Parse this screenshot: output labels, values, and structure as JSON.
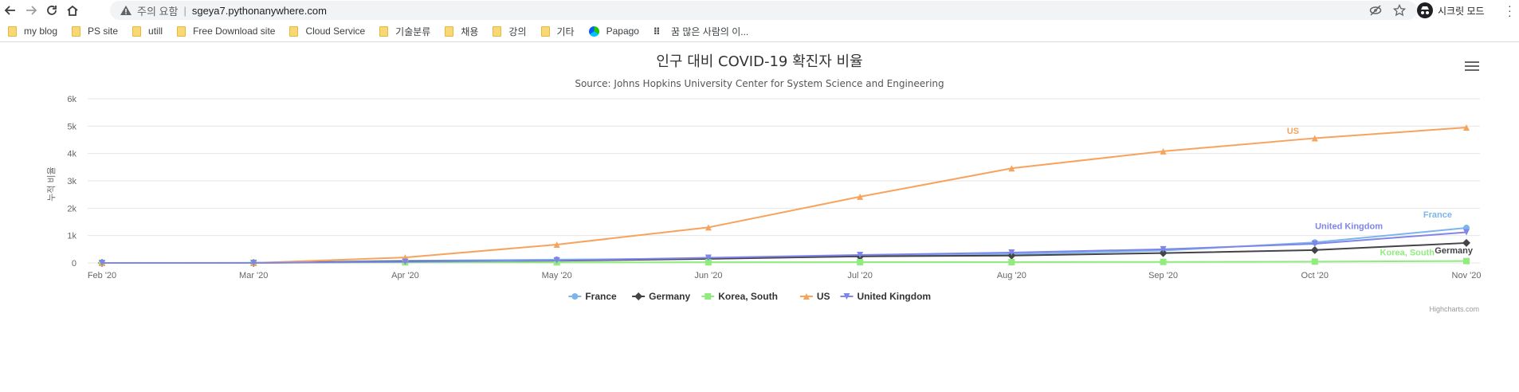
{
  "browser": {
    "security_label": "주의 요함",
    "url": "sgeya7.pythonanywhere.com",
    "incognito_label": "시크릿 모드"
  },
  "bookmarks": [
    {
      "label": "my blog",
      "icon": "folder-icon"
    },
    {
      "label": "PS site",
      "icon": "folder-icon"
    },
    {
      "label": "utill",
      "icon": "folder-icon"
    },
    {
      "label": "Free Download site",
      "icon": "folder-icon"
    },
    {
      "label": "Cloud Service",
      "icon": "folder-icon"
    },
    {
      "label": "기술분류",
      "icon": "folder-icon"
    },
    {
      "label": "채용",
      "icon": "folder-icon"
    },
    {
      "label": "강의",
      "icon": "folder-icon"
    },
    {
      "label": "기타",
      "icon": "folder-icon"
    },
    {
      "label": "Papago",
      "icon": "papago-icon"
    },
    {
      "label": "꿈 많은 사람의 이...",
      "icon": "dots-icon"
    }
  ],
  "chart_data": {
    "type": "line",
    "title": "인구 대비 COVID-19 확진자 비율",
    "subtitle": "Source: Johns Hopkins University Center for System Science and Engineering",
    "ylabel": "누적 비율",
    "ylim": [
      0,
      6000
    ],
    "yticks": [
      "0",
      "1k",
      "2k",
      "3k",
      "4k",
      "5k",
      "6k"
    ],
    "ytick_values": [
      0,
      1000,
      2000,
      3000,
      4000,
      5000,
      6000
    ],
    "xticks": [
      "Feb '20",
      "Mar '20",
      "Apr '20",
      "May '20",
      "Jun '20",
      "Jul '20",
      "Aug '20",
      "Sep '20",
      "Oct '20",
      "Nov '20"
    ],
    "x": [
      "2020-01-31",
      "2020-02-29",
      "2020-03-31",
      "2020-04-30",
      "2020-05-31",
      "2020-06-30",
      "2020-07-31",
      "2020-08-31",
      "2020-09-30",
      "2020-10-31"
    ],
    "series": [
      {
        "name": "France",
        "color": "#7cb5ec",
        "marker": "circle",
        "values": [
          0,
          2,
          80,
          120,
          160,
          240,
          320,
          450,
          750,
          1280
        ]
      },
      {
        "name": "Germany",
        "color": "#434348",
        "marker": "diamond",
        "values": [
          0,
          1,
          60,
          80,
          150,
          240,
          270,
          360,
          470,
          730
        ]
      },
      {
        "name": "Korea, South",
        "color": "#90ed7d",
        "marker": "square",
        "values": [
          0,
          5,
          20,
          20,
          25,
          28,
          30,
          38,
          47,
          68
        ]
      },
      {
        "name": "US",
        "color": "#f7a35c",
        "marker": "triangle",
        "values": [
          0,
          0,
          200,
          670,
          1300,
          2420,
          3460,
          4080,
          4560,
          4950
        ]
      },
      {
        "name": "United Kingdom",
        "color": "#8085e9",
        "marker": "triangle-down",
        "values": [
          0,
          1,
          40,
          90,
          190,
          290,
          380,
          500,
          700,
          1120
        ]
      }
    ],
    "series_labels": [
      {
        "name": "US",
        "text": "US"
      },
      {
        "name": "France",
        "text": "France"
      },
      {
        "name": "United Kingdom",
        "text": "United Kingdom"
      },
      {
        "name": "Korea, South",
        "text": "Korea, South"
      },
      {
        "name": "Germany",
        "text": "Germany"
      }
    ],
    "legend": "bottom-center",
    "grid": true,
    "credit": "Highcharts.com"
  }
}
